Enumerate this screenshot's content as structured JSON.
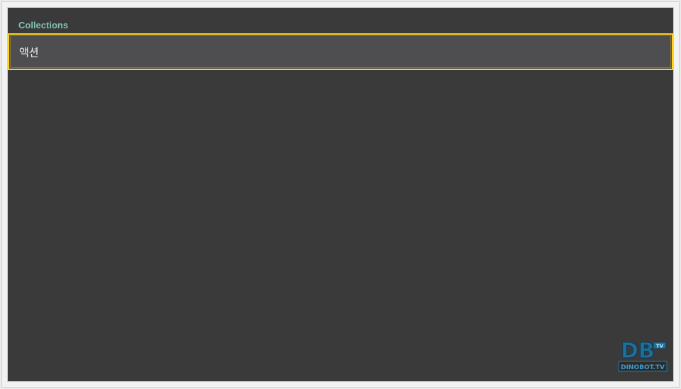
{
  "section": {
    "title": "Collections"
  },
  "list": {
    "items": [
      {
        "label": "액션"
      }
    ]
  },
  "watermark": {
    "logo_letters": "DB",
    "logo_text": "DINOBOT.TV",
    "tv_badge": "TV"
  },
  "colors": {
    "background": "#3a3a3a",
    "header_accent": "#7fc1b4",
    "focus_border": "#ffd21a",
    "item_background": "#4e4d4f"
  }
}
